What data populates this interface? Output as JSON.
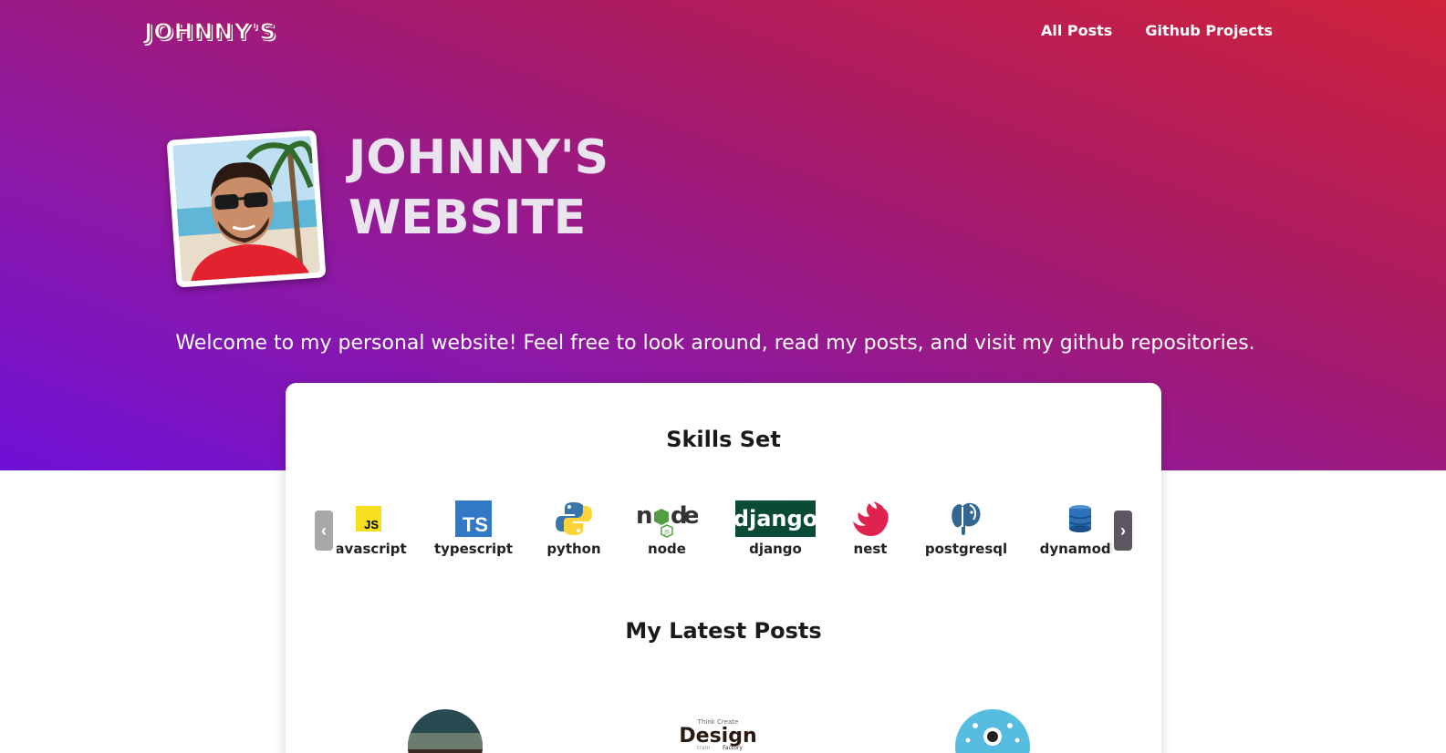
{
  "header": {
    "logo_text": "JOHNNY'S",
    "nav": [
      {
        "label": "All Posts"
      },
      {
        "label": "Github Projects"
      }
    ]
  },
  "hero": {
    "title_line1": "JOHNNY'S",
    "title_line2": "WEBSITE",
    "welcome": "Welcome to my personal website! Feel free to look around, read my posts, and visit my github repositories.",
    "gradient_colors": [
      "#d0223a",
      "#a81b66",
      "#8c18a8",
      "#6e10d6"
    ]
  },
  "skills": {
    "title": "Skills Set",
    "prev_icon": "chevron-left-icon",
    "next_icon": "chevron-right-icon",
    "items": [
      {
        "label": "javascript",
        "icon": "javascript-icon",
        "color": "#f7df1e"
      },
      {
        "label": "typescript",
        "icon": "typescript-icon",
        "color": "#3178c6"
      },
      {
        "label": "python",
        "icon": "python-icon",
        "color": "#3776ab"
      },
      {
        "label": "node",
        "icon": "node-icon",
        "color": "#539e43"
      },
      {
        "label": "django",
        "icon": "django-icon",
        "color": "#0c4b33"
      },
      {
        "label": "nest",
        "icon": "nest-icon",
        "color": "#e0234e"
      },
      {
        "label": "postgresql",
        "icon": "postgresql-icon",
        "color": "#336791"
      },
      {
        "label": "dynamodb",
        "icon": "dynamodb-icon",
        "color": "#2d72b8"
      }
    ]
  },
  "posts": {
    "title": "My Latest Posts",
    "thumbnails": [
      {
        "name": "post-thumbnail-1"
      },
      {
        "name": "post-thumbnail-design",
        "text": "Design"
      },
      {
        "name": "post-thumbnail-3"
      }
    ]
  }
}
